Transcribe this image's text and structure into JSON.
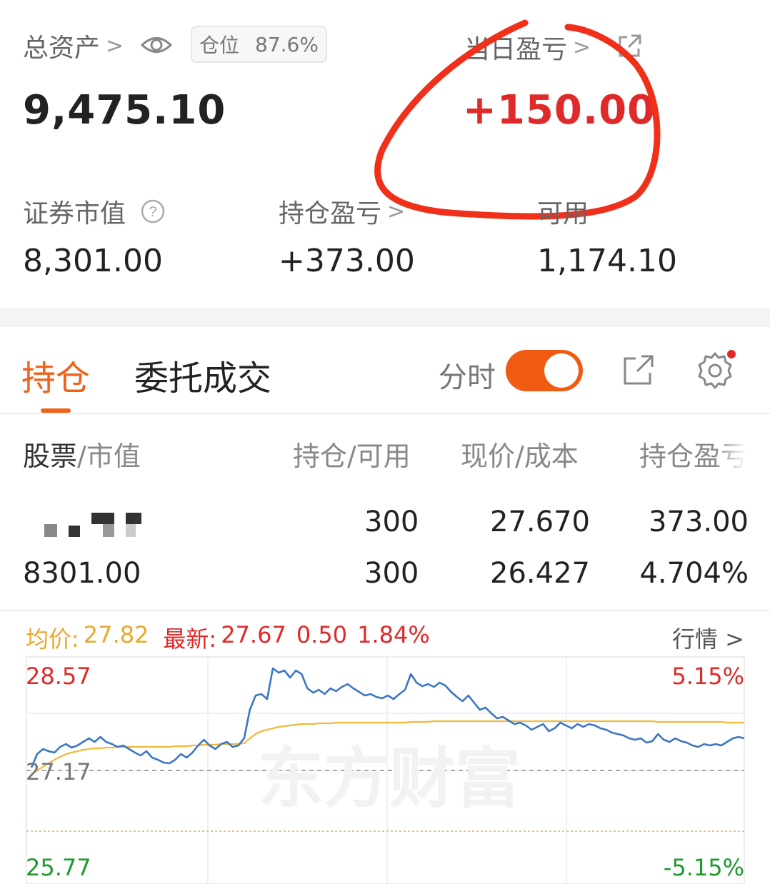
{
  "summary": {
    "total_assets_label": "总资产",
    "position_label": "仓位",
    "position_value": "87.6%",
    "total_assets_value": "9,475.10",
    "today_pnl_label": "当日盈亏",
    "today_pnl_value": "+150.00",
    "market_value_label": "证券市值",
    "market_value": "8,301.00",
    "holding_pnl_label": "持仓盈亏",
    "holding_pnl_value": "+373.00",
    "available_label": "可用",
    "available_value": "1,174.10"
  },
  "tabs": {
    "holdings": "持仓",
    "orders": "委托成交",
    "intraday_label": "分时"
  },
  "table": {
    "headers": {
      "stock": "股票",
      "market_value": "/市值",
      "qty": "持仓/可用",
      "price": "现价/成本",
      "pnl": "持仓盈亏"
    },
    "row": {
      "qty": "300",
      "available": "300",
      "price": "27.670",
      "cost": "26.427",
      "pnl": "373.00",
      "pnl_pct": "4.704%",
      "market_value": "8301.00"
    }
  },
  "quote": {
    "avg_label": "均价:",
    "avg_value": "27.82",
    "latest_label": "最新:",
    "latest_value": "27.67",
    "change": "0.50",
    "change_pct": "1.84%",
    "market_link": "行情 >"
  },
  "chart_data": {
    "type": "line",
    "y_high": "28.57",
    "y_mid": "27.17",
    "y_low": "25.77",
    "pct_high": "5.15%",
    "pct_low": "-5.15%",
    "watermark": "东方财富",
    "ylim": [
      25.77,
      28.57
    ],
    "series": [
      {
        "values": [
          27.19,
          27.38,
          27.45,
          27.42,
          27.4,
          27.48,
          27.52,
          27.47,
          27.5,
          27.55,
          27.6,
          27.55,
          27.62,
          27.55,
          27.52,
          27.48,
          27.5,
          27.45,
          27.4,
          27.36,
          27.42,
          27.33,
          27.3,
          27.26,
          27.25,
          27.3,
          27.38,
          27.33,
          27.4,
          27.5,
          27.58,
          27.5,
          27.45,
          27.52,
          27.55,
          27.48,
          27.5,
          27.6,
          28.0,
          28.2,
          28.22,
          28.15,
          28.58,
          28.52,
          28.55,
          28.45,
          28.55,
          28.5,
          28.3,
          28.24,
          28.28,
          28.22,
          28.3,
          28.26,
          28.32,
          28.36,
          28.3,
          28.25,
          28.2,
          28.22,
          28.18,
          28.16,
          28.2,
          28.15,
          28.22,
          28.28,
          28.5,
          28.38,
          28.33,
          28.36,
          28.32,
          28.38,
          28.34,
          28.25,
          28.18,
          28.12,
          28.2,
          28.1,
          28.0,
          28.03,
          27.95,
          27.88,
          27.9,
          27.85,
          27.8,
          27.82,
          27.78,
          27.72,
          27.76,
          27.8,
          27.7,
          27.74,
          27.82,
          27.78,
          27.74,
          27.8,
          27.76,
          27.8,
          27.78,
          27.74,
          27.72,
          27.68,
          27.66,
          27.64,
          27.6,
          27.58,
          27.6,
          27.54,
          27.56,
          27.66,
          27.58,
          27.55,
          27.6,
          27.56,
          27.54,
          27.5,
          27.48,
          27.52,
          27.5,
          27.52,
          27.5,
          27.55,
          27.6,
          27.62,
          27.6
        ]
      },
      {
        "values": [
          27.1,
          27.15,
          27.2,
          27.25,
          27.3,
          27.34,
          27.38,
          27.4,
          27.42,
          27.44,
          27.45,
          27.46,
          27.46,
          27.47,
          27.47,
          27.48,
          27.48,
          27.48,
          27.48,
          27.48,
          27.48,
          27.48,
          27.48,
          27.48,
          27.48,
          27.49,
          27.49,
          27.49,
          27.5,
          27.5,
          27.51,
          27.51,
          27.51,
          27.52,
          27.52,
          27.52,
          27.52,
          27.53,
          27.6,
          27.66,
          27.7,
          27.72,
          27.74,
          27.76,
          27.77,
          27.78,
          27.79,
          27.8,
          27.8,
          27.8,
          27.81,
          27.81,
          27.81,
          27.82,
          27.82,
          27.82,
          27.82,
          27.82,
          27.82,
          27.82,
          27.82,
          27.82,
          27.82,
          27.82,
          27.82,
          27.82,
          27.83,
          27.83,
          27.83,
          27.83,
          27.84,
          27.84,
          27.84,
          27.84,
          27.84,
          27.84,
          27.84,
          27.84,
          27.84,
          27.84,
          27.84,
          27.84,
          27.84,
          27.84,
          27.84,
          27.84,
          27.84,
          27.84,
          27.84,
          27.84,
          27.84,
          27.84,
          27.84,
          27.84,
          27.84,
          27.84,
          27.84,
          27.84,
          27.84,
          27.84,
          27.84,
          27.84,
          27.84,
          27.84,
          27.84,
          27.84,
          27.84,
          27.84,
          27.84,
          27.83,
          27.83,
          27.83,
          27.83,
          27.83,
          27.83,
          27.83,
          27.83,
          27.83,
          27.83,
          27.83,
          27.83,
          27.82,
          27.82,
          27.82,
          27.82
        ]
      }
    ]
  },
  "colors": {
    "accent": "#f0611a",
    "red": "#e02a2a",
    "green": "#1d9a2e",
    "price_line": "#3a76c4",
    "avg_line": "#f0b93a",
    "annotation": "#f0301a"
  }
}
